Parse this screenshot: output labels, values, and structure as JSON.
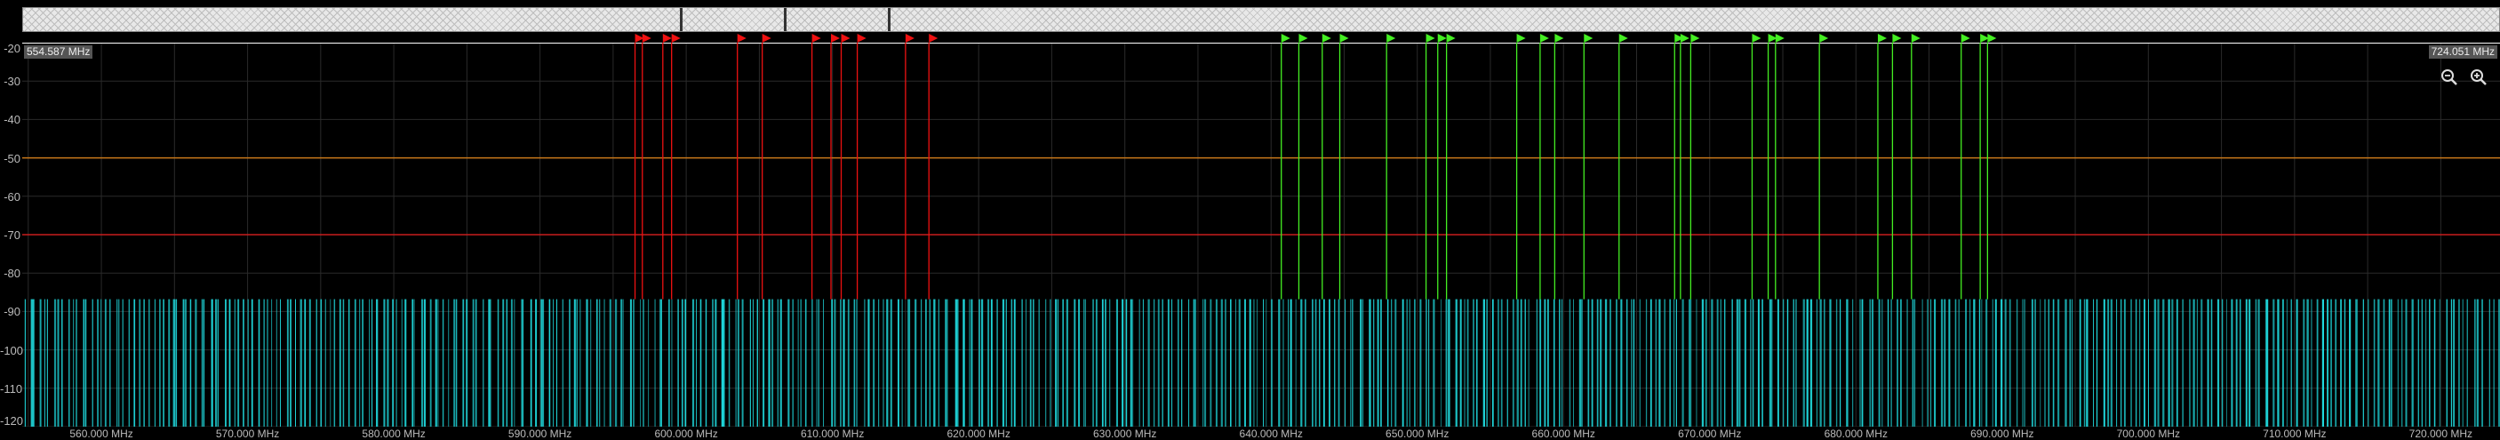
{
  "chart_data": {
    "type": "bar",
    "x_range_mhz": [
      554.587,
      724.051
    ],
    "ylim": [
      -120,
      -20
    ],
    "yticks": [
      -20,
      -30,
      -40,
      -50,
      -60,
      -70,
      -80,
      -90,
      -100,
      -110,
      -120
    ],
    "ytick_labels": [
      "-20",
      "-30",
      "-40",
      "-50",
      "-60",
      "-70",
      "-80",
      "-90",
      "-100",
      "-110",
      "-120"
    ],
    "xticks": [
      560,
      570,
      580,
      590,
      600,
      610,
      620,
      630,
      640,
      650,
      660,
      670,
      680,
      690,
      700,
      710,
      720
    ],
    "xtick_labels": [
      "560.000 MHz",
      "570.000 MHz",
      "580.000 MHz",
      "590.000 MHz",
      "600.000 MHz",
      "610.000 MHz",
      "620.000 MHz",
      "630.000 MHz",
      "640.000 MHz",
      "650.000 MHz",
      "660.000 MHz",
      "670.000 MHz",
      "680.000 MHz",
      "690.000 MHz",
      "700.000 MHz",
      "710.000 MHz",
      "720.000 MHz"
    ],
    "range_start_label": "554.587 MHz",
    "range_end_label": "724.051 MHz",
    "threshold_lines": [
      {
        "value": -50,
        "color": "#c8781a"
      },
      {
        "value": -70,
        "color": "#c81e1e"
      }
    ],
    "noise_floor": {
      "top": -86.8,
      "bottom": -120,
      "color": "#1fd8dc",
      "bar_count": 520
    },
    "red_markers_mhz": [
      596.5,
      597.0,
      598.4,
      599.0,
      603.5,
      605.2,
      608.6,
      609.9,
      610.6,
      611.7,
      615.0,
      616.6
    ],
    "green_markers_mhz": [
      640.7,
      641.9,
      643.5,
      644.7,
      647.9,
      650.6,
      651.4,
      652.0,
      656.8,
      658.4,
      659.4,
      661.4,
      663.8,
      667.6,
      668.0,
      668.7,
      672.9,
      674.0,
      674.5,
      677.5,
      681.5,
      682.5,
      683.8,
      687.2,
      688.5,
      689.0
    ],
    "colors": {
      "red_marker": "#ee1111",
      "green_marker": "#44ee22",
      "grid": "#2a2a2a",
      "axis": "#ffffff"
    }
  },
  "overview": {
    "handles_fraction": [
      0.265,
      0.307,
      0.349
    ]
  },
  "icons": {
    "zoom_out": "zoom-out-icon",
    "zoom_in": "zoom-in-icon"
  }
}
